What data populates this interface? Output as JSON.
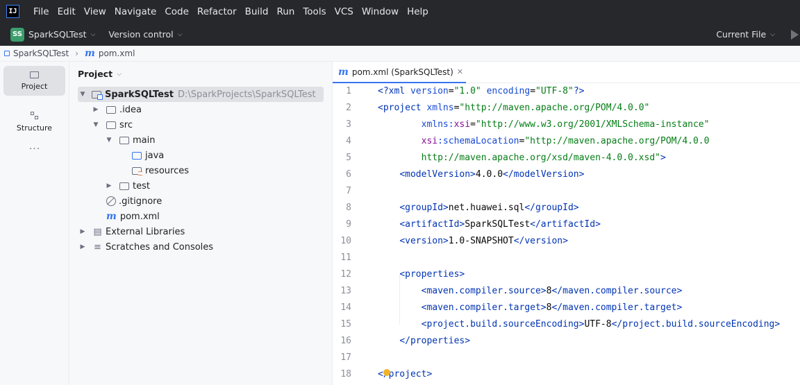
{
  "menubar": {
    "logo": "IJ",
    "items": [
      "File",
      "Edit",
      "View",
      "Navigate",
      "Code",
      "Refactor",
      "Build",
      "Run",
      "Tools",
      "VCS",
      "Window",
      "Help"
    ]
  },
  "toolbar": {
    "project_badge": "SS",
    "project_name": "SparkSQLTest",
    "version_control": "Version control",
    "current_file": "Current File"
  },
  "breadcrumb": {
    "project": "SparkSQLTest",
    "file": "pom.xml"
  },
  "stripe": {
    "project_label": "Project",
    "structure_label": "Structure",
    "more": "···"
  },
  "project_panel": {
    "title": "Project",
    "root_name": "SparkSQLTest",
    "root_path": "D:\\SparkProjects\\SparkSQLTest",
    "items": {
      "idea": ".idea",
      "src": "src",
      "main": "main",
      "java": "java",
      "resources": "resources",
      "test": "test",
      "gitignore": ".gitignore",
      "pom": "pom.xml",
      "ext_libs": "External Libraries",
      "scratches": "Scratches and Consoles"
    }
  },
  "editor": {
    "tab_label": "pom.xml (SparkSQLTest)",
    "line_numbers": [
      "1",
      "2",
      "3",
      "4",
      "5",
      "6",
      "7",
      "8",
      "9",
      "10",
      "11",
      "12",
      "13",
      "14",
      "15",
      "16",
      "17",
      "18"
    ]
  }
}
